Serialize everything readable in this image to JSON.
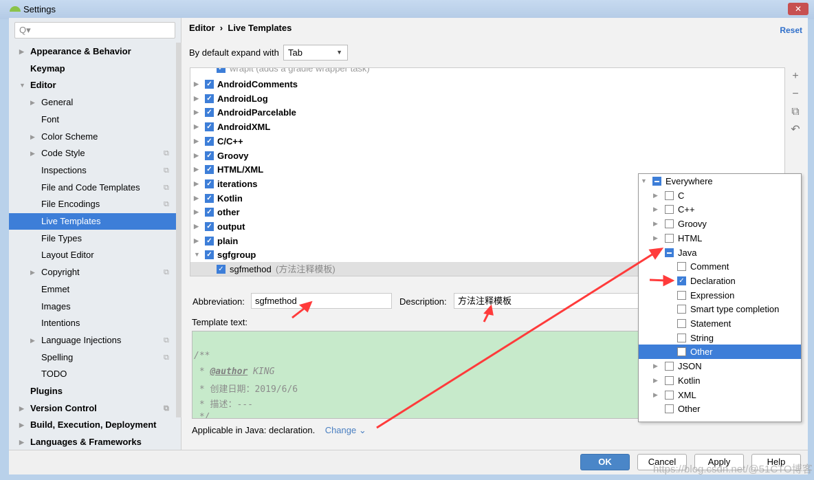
{
  "window": {
    "title": "Settings",
    "close": "✕"
  },
  "search": {
    "placeholder": "Q▾"
  },
  "sidebar": {
    "items": [
      {
        "label": "Appearance & Behavior",
        "bold": true,
        "level": 0,
        "arrow": "▶"
      },
      {
        "label": "Keymap",
        "bold": true,
        "level": 0,
        "arrow": ""
      },
      {
        "label": "Editor",
        "bold": true,
        "level": 0,
        "arrow": "▼"
      },
      {
        "label": "General",
        "level": 1,
        "arrow": "▶"
      },
      {
        "label": "Font",
        "level": 1,
        "arrow": ""
      },
      {
        "label": "Color Scheme",
        "level": 1,
        "arrow": "▶"
      },
      {
        "label": "Code Style",
        "level": 1,
        "arrow": "▶",
        "copy": true
      },
      {
        "label": "Inspections",
        "level": 1,
        "arrow": "",
        "copy": true
      },
      {
        "label": "File and Code Templates",
        "level": 1,
        "arrow": "",
        "copy": true
      },
      {
        "label": "File Encodings",
        "level": 1,
        "arrow": "",
        "copy": true
      },
      {
        "label": "Live Templates",
        "level": 1,
        "arrow": "",
        "selected": true
      },
      {
        "label": "File Types",
        "level": 1,
        "arrow": ""
      },
      {
        "label": "Layout Editor",
        "level": 1,
        "arrow": ""
      },
      {
        "label": "Copyright",
        "level": 1,
        "arrow": "▶",
        "copy": true
      },
      {
        "label": "Emmet",
        "level": 1,
        "arrow": ""
      },
      {
        "label": "Images",
        "level": 1,
        "arrow": ""
      },
      {
        "label": "Intentions",
        "level": 1,
        "arrow": ""
      },
      {
        "label": "Language Injections",
        "level": 1,
        "arrow": "▶",
        "copy": true
      },
      {
        "label": "Spelling",
        "level": 1,
        "arrow": "",
        "copy": true
      },
      {
        "label": "TODO",
        "level": 1,
        "arrow": ""
      },
      {
        "label": "Plugins",
        "bold": true,
        "level": 0,
        "arrow": ""
      },
      {
        "label": "Version Control",
        "bold": true,
        "level": 0,
        "arrow": "▶",
        "copy": true
      },
      {
        "label": "Build, Execution, Deployment",
        "bold": true,
        "level": 0,
        "arrow": "▶"
      },
      {
        "label": "Languages & Frameworks",
        "bold": true,
        "level": 0,
        "arrow": "▶"
      }
    ]
  },
  "breadcrumb": {
    "parent": "Editor",
    "sep": "›",
    "current": "Live Templates"
  },
  "reset": "Reset",
  "expand": {
    "label": "By default expand with",
    "value": "Tab"
  },
  "tree": {
    "partial": "wrapit (adds a gradle wrapper task)",
    "groups": [
      "AndroidComments",
      "AndroidLog",
      "AndroidParcelable",
      "AndroidXML",
      "C/C++",
      "Groovy",
      "HTML/XML",
      "iterations",
      "Kotlin",
      "other",
      "output",
      "plain",
      "sgfgroup"
    ],
    "child": {
      "name": "sgfmethod",
      "desc": "(方法注释模板)"
    }
  },
  "tools": [
    "+",
    "−",
    "⧉",
    "↶"
  ],
  "abbreviation": {
    "label": "Abbreviation:",
    "value": "sgfmethod"
  },
  "description": {
    "label": "Description:",
    "value": "方法注释模板"
  },
  "template": {
    "label": "Template text:",
    "lines": [
      "/**",
      " * @author KING",
      " * 创建日期：2019/6/6",
      " * 描述：---",
      " */"
    ],
    "tag": "@author",
    "author": " KING",
    "date_label": " * 创建日期：",
    "date": "2019/6/6"
  },
  "applicable": {
    "text": "Applicable in Java: declaration.",
    "change": "Change ⌄"
  },
  "buttons": {
    "ok": "OK",
    "cancel": "Cancel",
    "apply": "Apply",
    "help": "Help"
  },
  "popup": {
    "items": [
      {
        "label": "Everywhere",
        "level": 0,
        "arrow": "▼",
        "state": "mixed"
      },
      {
        "label": "C",
        "level": 1,
        "arrow": "▶",
        "state": "off"
      },
      {
        "label": "C++",
        "level": 1,
        "arrow": "▶",
        "state": "off"
      },
      {
        "label": "Groovy",
        "level": 1,
        "arrow": "▶",
        "state": "off"
      },
      {
        "label": "HTML",
        "level": 1,
        "arrow": "▶",
        "state": "off"
      },
      {
        "label": "Java",
        "level": 1,
        "arrow": "▼",
        "state": "mixed"
      },
      {
        "label": "Comment",
        "level": 2,
        "state": "off"
      },
      {
        "label": "Declaration",
        "level": 2,
        "state": "on"
      },
      {
        "label": "Expression",
        "level": 2,
        "state": "off"
      },
      {
        "label": "Smart type completion",
        "level": 2,
        "state": "off"
      },
      {
        "label": "Statement",
        "level": 2,
        "state": "off"
      },
      {
        "label": "String",
        "level": 2,
        "state": "off"
      },
      {
        "label": "Other",
        "level": 2,
        "state": "off",
        "selected": true
      },
      {
        "label": "JSON",
        "level": 1,
        "arrow": "▶",
        "state": "off"
      },
      {
        "label": "Kotlin",
        "level": 1,
        "arrow": "▶",
        "state": "off"
      },
      {
        "label": "XML",
        "level": 1,
        "arrow": "▶",
        "state": "off"
      },
      {
        "label": "Other",
        "level": 1,
        "state": "off"
      }
    ]
  },
  "watermark": "https://blog.csdn.net/@51CTO博客",
  "colors": {
    "accent": "#3d7ed8",
    "template_bg": "#c7eacb",
    "annotation": "#ff3b3b"
  }
}
